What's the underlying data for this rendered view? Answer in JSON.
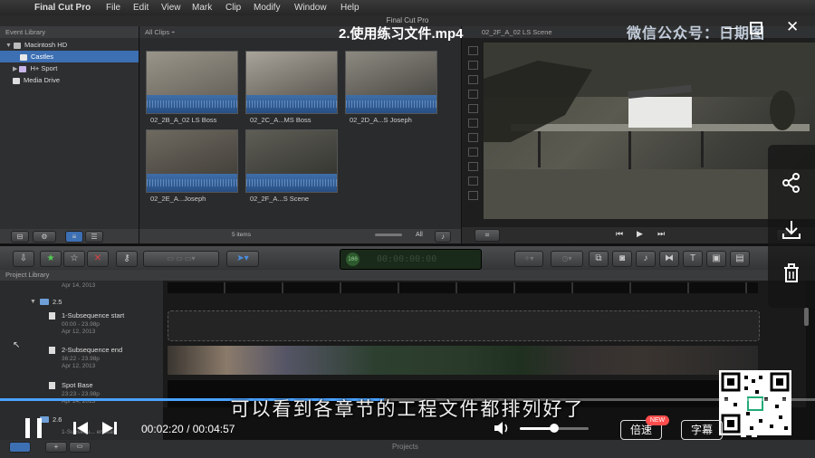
{
  "menubar": {
    "app": "Final Cut Pro",
    "items": [
      "File",
      "Edit",
      "View",
      "Mark",
      "Clip",
      "Modify",
      "Window",
      "Help"
    ]
  },
  "window": {
    "title": "Final Cut Pro"
  },
  "event_library": {
    "header": "Event Library",
    "items": [
      {
        "label": "Macintosh HD",
        "selected": false
      },
      {
        "label": "Castles",
        "selected": true
      },
      {
        "label": "H+ Sport",
        "selected": false
      },
      {
        "label": "Media Drive",
        "selected": false
      }
    ]
  },
  "browser": {
    "filter": "All Clips ÷",
    "clips": [
      {
        "name": "02_2B_A_02 LS Boss"
      },
      {
        "name": "02_2C_A...MS Boss"
      },
      {
        "name": "02_2D_A...S Joseph"
      },
      {
        "name": "02_2E_A...Joseph"
      },
      {
        "name": "02_2F_A...S Scene"
      }
    ],
    "count": "5 items",
    "all_label": "All"
  },
  "viewer": {
    "clip_name": "02_2F_A_02 LS Scene"
  },
  "toolbar": {
    "timecode_badge": "100",
    "timecode": "00:00:00:00"
  },
  "project_library": {
    "header": "Project Library",
    "date_top": "Apr 14, 2013",
    "folder_1": "2.5",
    "projects": [
      {
        "title": "1-Subsequence start",
        "detail": "00:00 - 23.98p",
        "date": "Apr 12, 2013"
      },
      {
        "title": "2-Subsequence end",
        "detail": "36:22 - 23.98p",
        "date": "Apr 12, 2013"
      },
      {
        "title": "Spot Base",
        "detail": "23:23 - 23.98p",
        "date": "Apr 14, 2013"
      }
    ],
    "folder_2": "2.6",
    "partial_project": "1-Subsequ... en start",
    "footer": "Projects"
  },
  "player": {
    "title": "2.使用练习文件.mp4",
    "watermark": "微信公众号：日期图",
    "subtitle": "可以看到各章节的工程文件都排列好了",
    "current_time": "00:02:20",
    "total_time": "00:04:57",
    "progress": 0.471,
    "volume": 0.5,
    "speed_label": "倍速",
    "new_badge": "NEW",
    "caption_label": "字幕",
    "accent": "#4aa3ff"
  }
}
